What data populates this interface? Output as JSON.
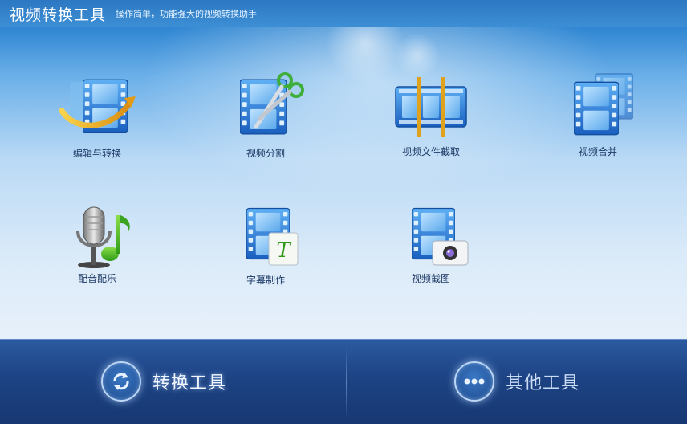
{
  "header": {
    "title": "视频转换工具",
    "subtitle": "操作简单，功能强大的视频转换助手"
  },
  "tools": [
    {
      "label": "编辑与转换",
      "icon": "film-convert-icon"
    },
    {
      "label": "视频分割",
      "icon": "film-scissors-icon"
    },
    {
      "label": "视频文件截取",
      "icon": "film-trim-icon"
    },
    {
      "label": "视频合并",
      "icon": "film-merge-icon"
    },
    {
      "label": "配音配乐",
      "icon": "microphone-music-icon"
    },
    {
      "label": "字幕制作",
      "icon": "film-subtitle-icon"
    },
    {
      "label": "视频截图",
      "icon": "film-camera-icon"
    }
  ],
  "bottom_tabs": [
    {
      "label": "转换工具",
      "icon": "refresh-icon",
      "active": true
    },
    {
      "label": "其他工具",
      "icon": "more-dots-icon",
      "active": false
    }
  ],
  "colors": {
    "title_bar": "#2c78c2",
    "bottom_bar": "#1d4384",
    "film_blue": "#2a78d6",
    "label_text": "#1d3a66"
  }
}
